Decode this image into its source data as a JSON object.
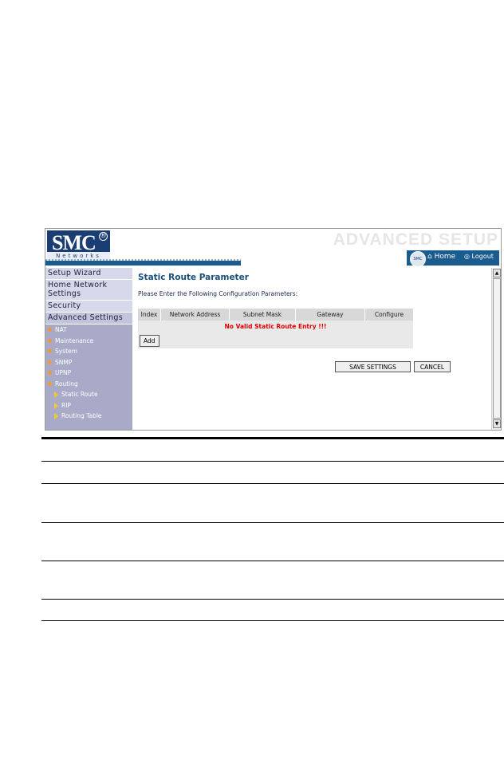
{
  "header": {
    "logo_text": "SMC",
    "logo_reg": "®",
    "logo_sub": "Networks",
    "title": "ADVANCED SETUP",
    "home_label": "Home",
    "logout_label": "Logout",
    "badge_text": "SMC"
  },
  "sidebar": {
    "main_items": [
      "Setup Wizard",
      "Home Network Settings",
      "Security",
      "Advanced Settings"
    ],
    "sub_items": [
      "NAT",
      "Maintenance",
      "System",
      "SNMP",
      "UPNP",
      "Routing"
    ],
    "routing_items": [
      "Static Route",
      "RIP",
      "Routing Table"
    ]
  },
  "content": {
    "title": "Static Route Parameter",
    "instructions": "Please Enter the Following Configuration Parameters:",
    "table": {
      "headers": [
        "Index",
        "Network Address",
        "Subnet Mask",
        "Gateway",
        "Configure"
      ],
      "empty_message": "No Valid Static Route Entry !!!"
    },
    "add_label": "Add",
    "save_label": "SAVE SETTINGS",
    "cancel_label": "CANCEL"
  },
  "scrollbar": {
    "up_arrow": "▲",
    "down_arrow": "▼"
  },
  "colors": {
    "brand": "#1a3d74",
    "nav_blue": "#1b5c8f",
    "sidebar_bg": "#a8aac8",
    "bullet": "#f39a2e",
    "error": "#e00000"
  }
}
